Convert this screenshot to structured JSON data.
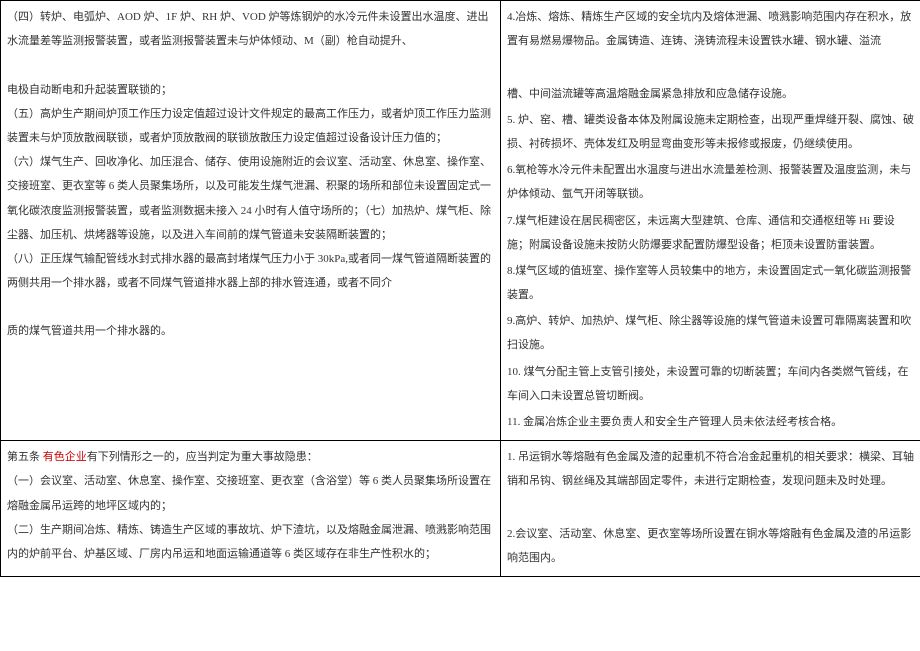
{
  "row1": {
    "left": {
      "p1": "（四）转炉、电弧炉、AOD 炉、1F 炉、RH 炉、VOD 炉等炼钢炉的水冷元件未设置出水温度、进出水流量差等监测报警装置，或者监测报警装置未与炉体倾动、M（副）枪自动提升、",
      "p2": " ",
      "p3": "电极自动断电和升起装置联锁的；",
      "p4": "（五）高炉生产期间炉顶工作压力设定值超过设计文件规定的最高工作压力，或者炉顶工作压力监测装置未与炉顶放散阀联锁，或者炉顶放散阀的联锁放散压力设定值超过设备设计压力值的；",
      "p5": "（六）煤气生产、回收净化、加压混合、储存、使用设施附近的会议室、活动室、休息室、操作室、交接班室、更衣室等 6 类人员聚集场所，以及可能发生煤气泄漏、积聚的场所和部位未设置固定式一氧化碳浓度监测报警装置，或者监测数据未接入 24 小时有人值守场所的；（七）加热炉、煤气柜、除尘器、加压机、烘烤器等设施，以及进入车间前的煤气管道未安装隔断装置的；",
      "p6": "（八）正压煤气输配管线水封式排水器的最高封堵煤气压力小于 30kPa,或者同一煤气管道隔断装置的两侧共用一个排水器，或者不同煤气管道排水器上部的排水管连通，或者不同介",
      "p7": " ",
      "p8": "质的煤气管道共用一个排水器的。"
    },
    "right": {
      "p1": "4.冶炼、熔炼、精炼生产区域的安全坑内及熔体泄漏、喷溅影响范围内存在积水，放置有易燃易爆物品。金属铸造、连铸、浇铸流程未设置铁水罐、钢水罐、溢流",
      "p2": " ",
      "p3": "槽、中间溢流罐等高温熔融金属紧急排放和应急储存设施。",
      "p4": "5. 炉、窑、槽、罐类设备本体及附属设施未定期检查，出现严重焊缝开裂、腐蚀、破损、衬砖损坏、壳体发红及明显弯曲变形等未报修或报废，仍继续使用。",
      "p5": "6.氧枪等水冷元件未配置出水温度与进出水流量差检测、报警装置及温度监测，未与炉体倾动、氩气开闭等联锁。",
      "p6": "7.煤气柜建设在居民稠密区，未远离大型建筑、仓库、通信和交通枢纽等 Hi 要设施；附属设备设施未按防火防爆要求配置防爆型设备；柜顶未设置防雷装置。",
      "p7": "8.煤气区域的值班室、操作室等人员较集中的地方，未设置固定式一氧化碳监测报警装置。",
      "p8": "9.高炉、转炉、加热炉、煤气柜、除尘器等设施的煤气管道未设置可靠隔离装置和吹扫设施。",
      "p9": "10. 煤气分配主管上支管引接处，未设置可靠的切断装置；车间内各类燃气管线，在车间入口未设置总管切断阀。",
      "p10": "11. 金属冶炼企业主要负责人和安全生产管理人员未依法经考核合格。"
    }
  },
  "row2": {
    "left": {
      "p1a": "第五条 ",
      "p1b": "有色企业",
      "p1c": "有下列情形之一的，应当判定为重大事故隐患：",
      "p2": "（一）会议室、活动室、休息室、操作室、交接班室、更衣室（含浴堂）等 6 类人员聚集场所设置在熔融金属吊运跨的地坪区域内的；",
      "p3": "（二）生产期间冶炼、精炼、铸造生产区域的事故坑、炉下渣坑，以及熔融金属泄漏、喷溅影响范围内的炉前平台、炉基区域、厂房内吊运和地面运输通道等 6 类区域存在非生产性积水的；"
    },
    "right": {
      "p1": "1. 吊运铜水等熔融有色金属及渣的起重机不符合冶金起重机的相关要求：横梁、耳轴销和吊钩、钢丝绳及其端部固定零件，未进行定期检查，发现问题未及时处理。",
      "p2": " ",
      "p3": "2.会议室、活动室、休息室、更衣室等场所设置在铜水等熔融有色金属及渣的吊运影响范围内。"
    }
  }
}
